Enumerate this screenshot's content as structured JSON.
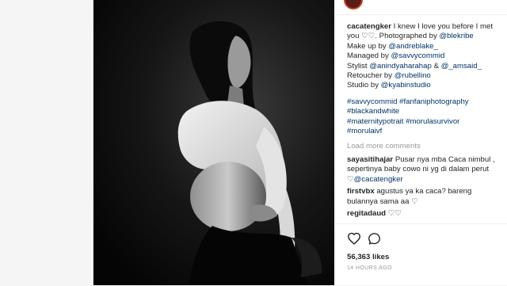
{
  "post": {
    "header_username": "cacatengker",
    "caption": {
      "username": "cacatengker",
      "line1": "I knew I love you before I met you ♡♡. Photographed by ",
      "photographer": "@blekribe",
      "makeup_label": "Make up by ",
      "makeup": "@andreblake_",
      "managed_label": "Managed by ",
      "managed": "@savvycommid",
      "stylist_label": "Stylist ",
      "stylist1": "@anindyaharahap",
      "stylist_and": " & ",
      "stylist2": "@_amsaid_",
      "retoucher_label": "Retoucher by ",
      "retoucher": "@rubellino",
      "studio_label": "Studio by ",
      "studio": "@kyabinstudio"
    },
    "hashtags": [
      "#savvycommid",
      "#fanfaniphotography",
      "#blackandwhite",
      "#maternitypotrait",
      "#morulasurvivor",
      "#morulaivf"
    ],
    "load_more": "Load more comments",
    "comments": [
      {
        "username": "sayasitihajar",
        "text": "Pusar nya mba Caca nimbul , sepertinya baby cowo ni yg di dalam perut ♡",
        "mention": "@cacatengker"
      },
      {
        "username": "firstvbx",
        "text": "agustus ya ka caca? bareng bulannya sama aa ♡",
        "mention": ""
      },
      {
        "username": "regitadaud",
        "text": "♡♡",
        "mention": ""
      }
    ],
    "likes": "56,363 likes",
    "time": "14 HOURS AGO"
  },
  "icons": {
    "like": "heart-outline-icon",
    "comment": "speech-bubble-icon"
  },
  "colors": {
    "link": "#003569",
    "muted": "#999999",
    "text": "#262626"
  }
}
